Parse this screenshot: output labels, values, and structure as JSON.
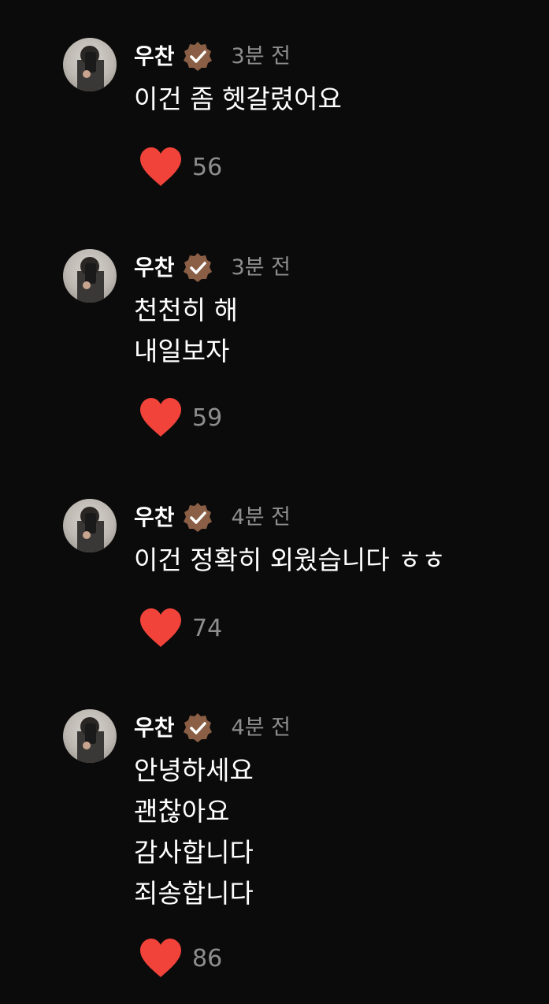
{
  "comments": [
    {
      "author": "우찬",
      "time": "3분 전",
      "text": "이건 좀 헷갈렸어요",
      "likes": "56"
    },
    {
      "author": "우찬",
      "time": "3분 전",
      "text": "천천히 해\n내일보자",
      "likes": "59"
    },
    {
      "author": "우찬",
      "time": "4분 전",
      "text": "이건 정확히 외웠습니다 ㅎㅎ",
      "likes": "74"
    },
    {
      "author": "우찬",
      "time": "4분 전",
      "text": "안녕하세요\n괜찮아요\n감사합니다\n죄송합니다",
      "likes": "86"
    }
  ],
  "colors": {
    "background": "#0c0b0b",
    "heart": "#f2433a",
    "badge": "#8a5f45",
    "muted_text": "#8e8e8e"
  },
  "icons": {
    "like": "heart-icon",
    "verified": "verified-badge-icon"
  }
}
